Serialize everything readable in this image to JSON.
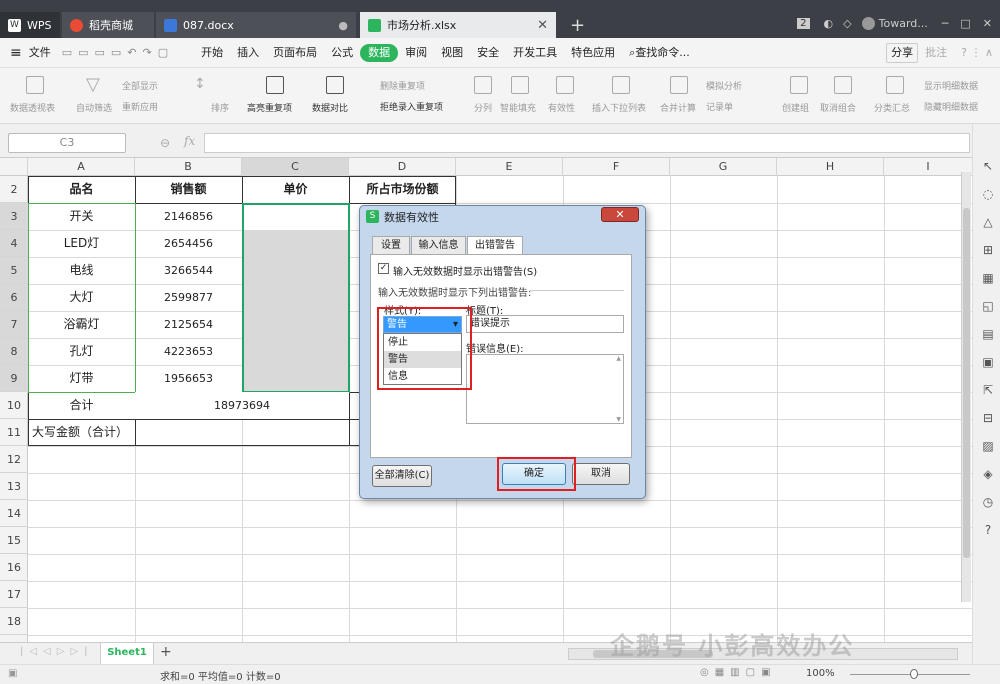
{
  "tabs": {
    "wps": "WPS",
    "shop": "稻壳商城",
    "doc": "087.docx",
    "xls": "市场分析.xlsx",
    "add": "+"
  },
  "titlebar_right": {
    "badge": "2",
    "user": "Toward..."
  },
  "menu": {
    "file": "文件",
    "items": [
      "开始",
      "插入",
      "页面布局",
      "公式",
      "数据",
      "审阅",
      "视图",
      "安全",
      "开发工具",
      "特色应用"
    ],
    "active": "数据",
    "search": "查找命令...",
    "share": "分享",
    "comment": "批注"
  },
  "ribbon": [
    "数据透视表",
    "自动筛选",
    "全部显示",
    "重新应用",
    "排序",
    "高亮重复项",
    "数据对比",
    "删除重复项",
    "拒绝录入重复项",
    "分列",
    "智能填充",
    "有效性",
    "插入下拉列表",
    "合并计算",
    "模拟分析",
    "记录单",
    "创建组",
    "取消组合",
    "分类汇总",
    "显示明细数据",
    "隐藏明细数据"
  ],
  "formula": {
    "namebox": "C3",
    "fx": "fx"
  },
  "columns": [
    "A",
    "B",
    "C",
    "D",
    "E",
    "F",
    "G",
    "H",
    "I"
  ],
  "rows": [
    "2",
    "3",
    "4",
    "5",
    "6",
    "7",
    "8",
    "9",
    "10",
    "11",
    "12",
    "13",
    "14",
    "15",
    "16",
    "17",
    "18"
  ],
  "table": {
    "headers": [
      "品名",
      "销售额",
      "单价",
      "所占市场份额"
    ],
    "items": [
      {
        "name": "开关",
        "sales": "2146856"
      },
      {
        "name": "LED灯",
        "sales": "2654456"
      },
      {
        "name": "电线",
        "sales": "3266544"
      },
      {
        "name": "大灯",
        "sales": "2599877"
      },
      {
        "name": "浴霸灯",
        "sales": "2125654"
      },
      {
        "name": "孔灯",
        "sales": "4223653"
      },
      {
        "name": "灯带",
        "sales": "1956653"
      }
    ],
    "total_label": "合计",
    "total_value": "18973694",
    "caps_label": "大写金额（合计）"
  },
  "dialog": {
    "title": "数据有效性",
    "tabs": [
      "设置",
      "输入信息",
      "出错警告"
    ],
    "active_tab": "出错警告",
    "checkbox_label": "输入无效数据时显示出错警告(S)",
    "checkbox_checked": true,
    "section_label": "输入无效数据时显示下列出错警告:",
    "style_label": "样式(Y):",
    "style_value": "警告",
    "style_options": [
      "停止",
      "警告",
      "信息"
    ],
    "title_label": "标题(T):",
    "title_value": "错误提示",
    "error_label": "错误信息(E):",
    "clear_all": "全部清除(C)",
    "ok": "确定",
    "cancel": "取消"
  },
  "sheet": {
    "tab": "Sheet1",
    "add": "+"
  },
  "status": {
    "text": "求和=0  平均值=0  计数=0",
    "zoom": "100%"
  },
  "watermark": "企鹅号 小彭高效办公",
  "colors": {
    "accent": "#2db55d",
    "titlebar": "#3c3f45",
    "highlight": "#e02020",
    "selection": "#21a366"
  }
}
